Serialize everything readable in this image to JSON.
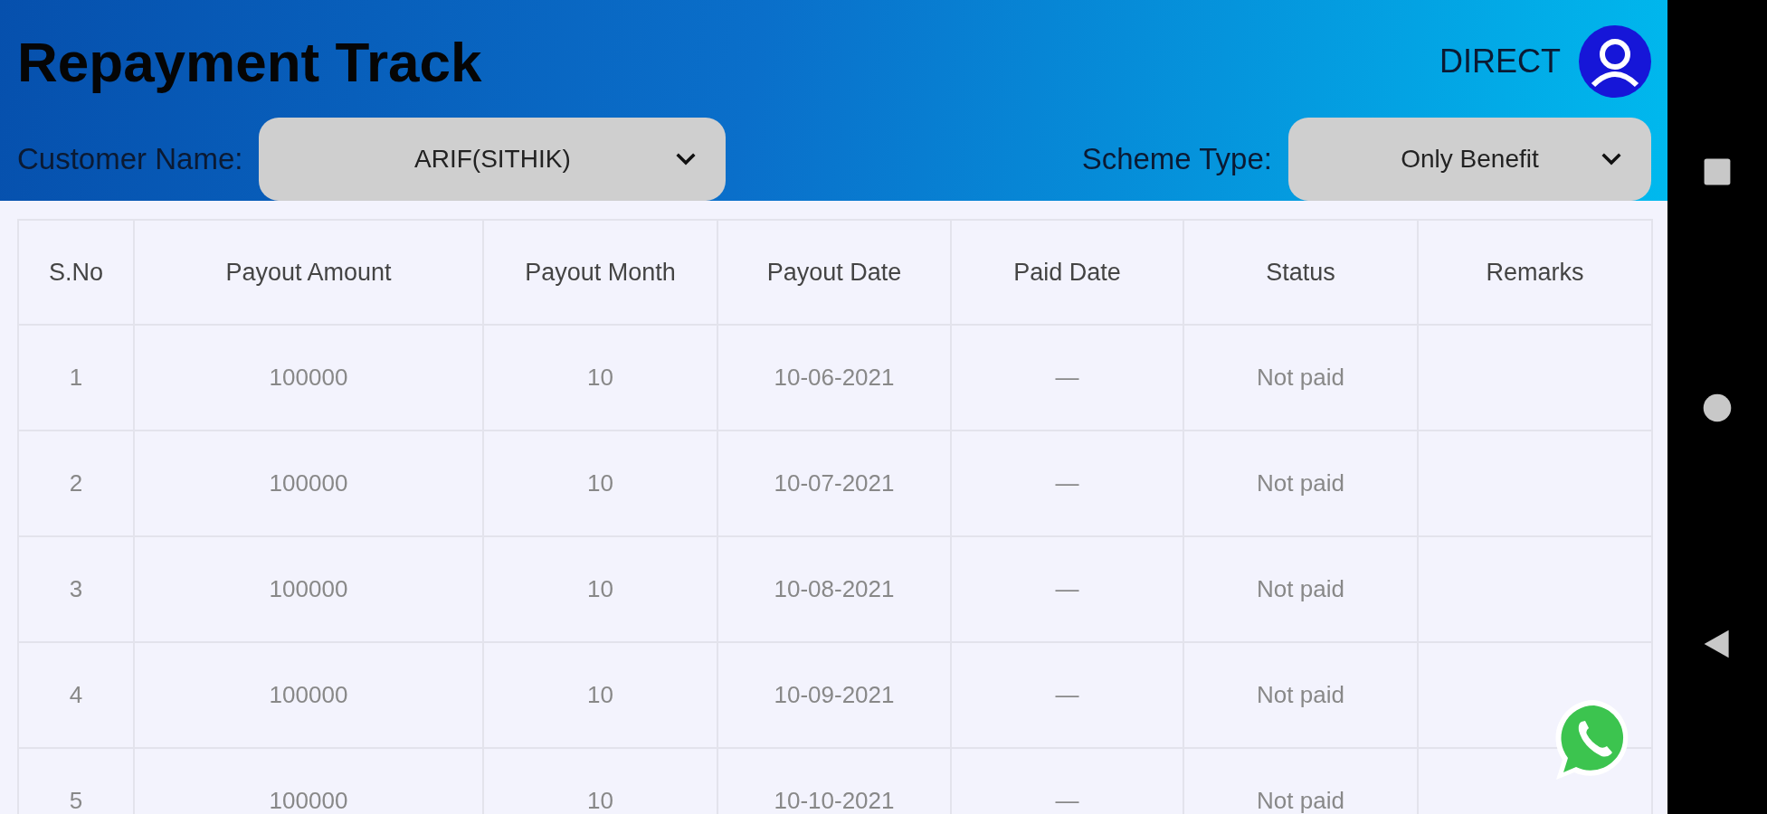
{
  "header": {
    "title": "Repayment Track",
    "user": "DIRECT"
  },
  "filters": [
    {
      "label": "Customer Name:",
      "value": "ARIF(SITHIK)"
    },
    {
      "label": "Scheme Type:",
      "value": "Only Benefit"
    }
  ],
  "table": {
    "columns": [
      "S.No",
      "Payout Amount",
      "Payout Month",
      "Payout Date",
      "Paid Date",
      "Status",
      "Remarks"
    ],
    "rows": [
      [
        "1",
        "100000",
        "10",
        "10-06-2021",
        "—",
        "Not paid"
      ],
      [
        "2",
        "100000",
        "10",
        "10-07-2021",
        "—",
        "Not paid"
      ],
      [
        "3",
        "100000",
        "10",
        "10-08-2021",
        "—",
        "Not paid"
      ],
      [
        "4",
        "100000",
        "10",
        "10-09-2021",
        "—",
        "Not paid"
      ],
      [
        "5",
        "100000",
        "10",
        "10-10-2021",
        "—",
        "Not paid"
      ]
    ]
  }
}
